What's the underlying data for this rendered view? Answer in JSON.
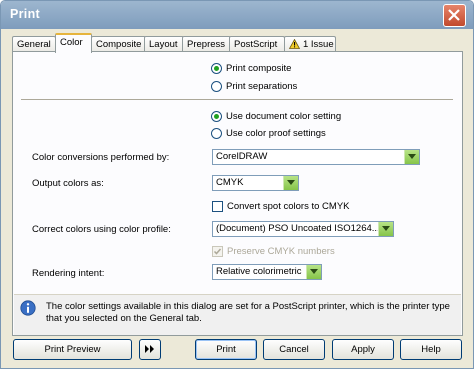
{
  "window": {
    "title": "Print"
  },
  "tabs": [
    "General",
    "Color",
    "Composite",
    "Layout",
    "Prepress",
    "PostScript",
    "1 Issue"
  ],
  "active_tab": "Color",
  "composite": {
    "options": [
      "Print composite",
      "Print separations"
    ],
    "selected": "Print composite"
  },
  "color_source": {
    "options": [
      "Use document color setting",
      "Use color proof settings"
    ],
    "selected": "Use document color setting"
  },
  "fields": {
    "conversions_label": "Color conversions performed by:",
    "conversions_value": "CorelDRAW",
    "output_label": "Output colors as:",
    "output_value": "CMYK",
    "convert_spot_label": "Convert spot colors to CMYK",
    "convert_spot_checked": false,
    "profile_label": "Correct colors using color profile:",
    "profile_value": "(Document) PSO Uncoated ISO1264...",
    "preserve_label": "Preserve CMYK numbers",
    "preserve_checked": true,
    "preserve_disabled": true,
    "intent_label": "Rendering intent:",
    "intent_value": "Relative colorimetric"
  },
  "info": {
    "text": "The color settings available in this dialog are set for a PostScript printer, which is the printer type that you selected on the General tab."
  },
  "buttons": {
    "preview": "Print Preview",
    "print": "Print",
    "cancel": "Cancel",
    "apply": "Apply",
    "help": "Help"
  },
  "colors": {
    "titlebar": "#8aa7c6",
    "dialog_bg": "#ece9d8",
    "radio_dot": "#21a121",
    "select_arrow": "#9fd46a"
  }
}
